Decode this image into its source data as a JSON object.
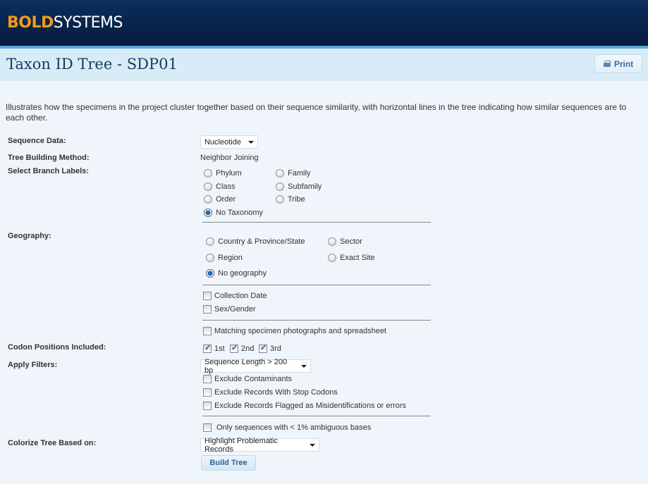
{
  "brand": {
    "bold": "BOLD",
    "systems": "SYSTEMS"
  },
  "header": {
    "title": "Taxon ID Tree - SDP01",
    "print_label": "Print"
  },
  "description": "Illustrates how the specimens in the project cluster together based on their sequence similarity, with horizontal lines in the tree indicating how similar sequences are to each other.",
  "form": {
    "sequence_data": {
      "label": "Sequence Data:",
      "value": "Nucleotide"
    },
    "tree_method": {
      "label": "Tree Building Method:",
      "value": "Neighbor Joining"
    },
    "branch_labels": {
      "label": "Select Branch Labels:",
      "options": [
        "Phylum",
        "Class",
        "Order",
        "No Taxonomy",
        "Family",
        "Subfamily",
        "Tribe"
      ],
      "selected": "No Taxonomy"
    },
    "geography": {
      "label": "Geography:",
      "options": [
        "Country &  Province/State",
        "Region",
        "No geography",
        "Sector",
        "Exact Site"
      ],
      "selected": "No geography"
    },
    "extra_checks": [
      {
        "label": "Collection Date",
        "checked": false
      },
      {
        "label": "Sex/Gender",
        "checked": false
      },
      {
        "label": "Matching specimen photographs and spreadsheet",
        "checked": false
      }
    ],
    "codon_positions": {
      "label": "Codon Positions Included:",
      "options": [
        {
          "label": "1st",
          "checked": true
        },
        {
          "label": "2nd",
          "checked": true
        },
        {
          "label": "3rd",
          "checked": true
        }
      ]
    },
    "filters": {
      "label": "Apply Filters:",
      "value": "Sequence Length > 200 bp",
      "checks": [
        {
          "label": "Exclude Contaminants",
          "checked": false
        },
        {
          "label": "Exclude Records With Stop Codons",
          "checked": false
        },
        {
          "label": "Exclude Records Flagged as Misidentifications or errors",
          "checked": false
        },
        {
          "label": "Only sequences with < 1% ambiguous bases",
          "checked": false
        }
      ]
    },
    "colorize": {
      "label": "Colorize Tree Based on:",
      "value": "Highlight Problematic Records"
    },
    "build_label": "Build Tree"
  }
}
